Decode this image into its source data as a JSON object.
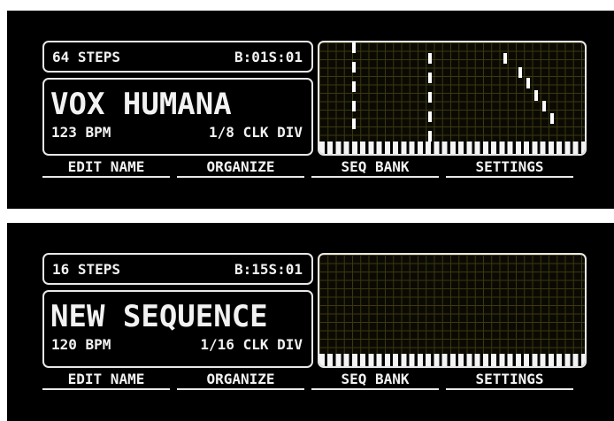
{
  "screens": [
    {
      "steps": "64 STEPS",
      "position": "B:01S:01",
      "name": "VOX HUMANA",
      "bpm": "123 BPM",
      "clock_div": "1/8 CLK DIV",
      "menu": [
        "EDIT NAME",
        "ORGANIZE",
        "SEQ BANK",
        "SETTINGS"
      ]
    },
    {
      "steps": "16 STEPS",
      "position": "B:15S:01",
      "name": "NEW SEQUENCE",
      "bpm": "120 BPM",
      "clock_div": "1/16 CLK DIV",
      "menu": [
        "EDIT NAME",
        "ORGANIZE",
        "SEQ BANK",
        "SETTINGS"
      ]
    }
  ],
  "colors": {
    "background": "#000000",
    "text": "#f2f2f2",
    "grid_line": "#3b3812",
    "note": "#ffffff"
  }
}
